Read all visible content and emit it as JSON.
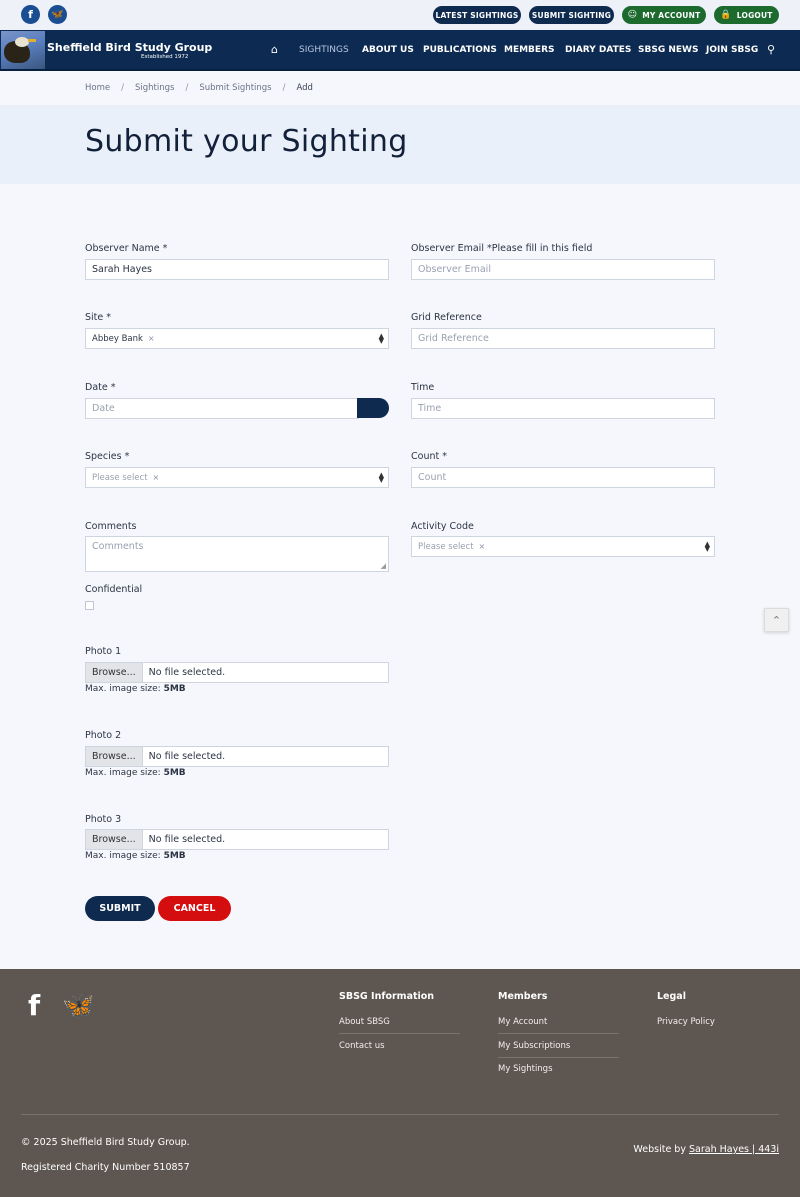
{
  "topbar": {
    "social": [
      {
        "icon": "facebook-icon",
        "glyph": "f"
      },
      {
        "icon": "bluesky-icon",
        "glyph": "🦋"
      }
    ],
    "buttons": {
      "latest": "LATEST SIGHTINGS",
      "submit": "SUBMIT SIGHTING",
      "account": "MY ACCOUNT",
      "logout": "LOGOUT"
    }
  },
  "header": {
    "title": "Sheffield Bird Study Group",
    "subtitle": "Established 1972",
    "nav": [
      "SIGHTINGS",
      "ABOUT US",
      "PUBLICATIONS",
      "MEMBERS",
      "DIARY DATES",
      "SBSG NEWS",
      "JOIN SBSG"
    ],
    "active_nav": "SIGHTINGS"
  },
  "breadcrumb": [
    "Home",
    "Sightings",
    "Submit Sightings",
    "Add"
  ],
  "page_title": "Submit your Sighting",
  "form": {
    "observer_name": {
      "label": "Observer Name *",
      "value": "Sarah Hayes"
    },
    "observer_email": {
      "label": "Observer Email *Please fill in this field",
      "placeholder": "Observer Email"
    },
    "site": {
      "label": "Site *",
      "value": "Abbey Bank",
      "clear": "×"
    },
    "grid_ref": {
      "label": "Grid Reference",
      "placeholder": "Grid Reference"
    },
    "date": {
      "label": "Date *",
      "placeholder": "Date"
    },
    "time": {
      "label": "Time",
      "placeholder": "Time"
    },
    "species": {
      "label": "Species *",
      "placeholder": "Please select",
      "clear": "×"
    },
    "count": {
      "label": "Count *",
      "placeholder": "Count"
    },
    "comments": {
      "label": "Comments",
      "placeholder": "Comments"
    },
    "activity": {
      "label": "Activity Code",
      "placeholder": "Please select",
      "clear": "×"
    },
    "confidential": {
      "label": "Confidential"
    },
    "photos": [
      {
        "label": "Photo 1",
        "button": "Browse...",
        "status": "No file selected.",
        "max_label": "Max. image size: ",
        "max_value": "5MB"
      },
      {
        "label": "Photo 2",
        "button": "Browse...",
        "status": "No file selected.",
        "max_label": "Max. image size: ",
        "max_value": "5MB"
      },
      {
        "label": "Photo 3",
        "button": "Browse...",
        "status": "No file selected.",
        "max_label": "Max. image size: ",
        "max_value": "5MB"
      }
    ],
    "submit_label": "SUBMIT",
    "cancel_label": "CANCEL"
  },
  "footer": {
    "info": {
      "heading": "SBSG Information",
      "links": [
        "About SBSG",
        "Contact us"
      ]
    },
    "members": {
      "heading": "Members",
      "links": [
        "My Account",
        "My Subscriptions",
        "My Sightings"
      ]
    },
    "legal": {
      "heading": "Legal",
      "links": [
        "Privacy Policy"
      ]
    },
    "copyright": "© 2025 Sheffield Bird Study Group.",
    "charity": "Registered Charity Number 510857",
    "credit_prefix": "Website by ",
    "credit_link": "Sarah Hayes | 443i"
  },
  "colors": {
    "navy": "#0e2a4f",
    "green": "#1c6a2e",
    "cancel_red": "#d40e0e",
    "footer_bg": "#5e5650",
    "title_band": "#eaf0f9"
  }
}
